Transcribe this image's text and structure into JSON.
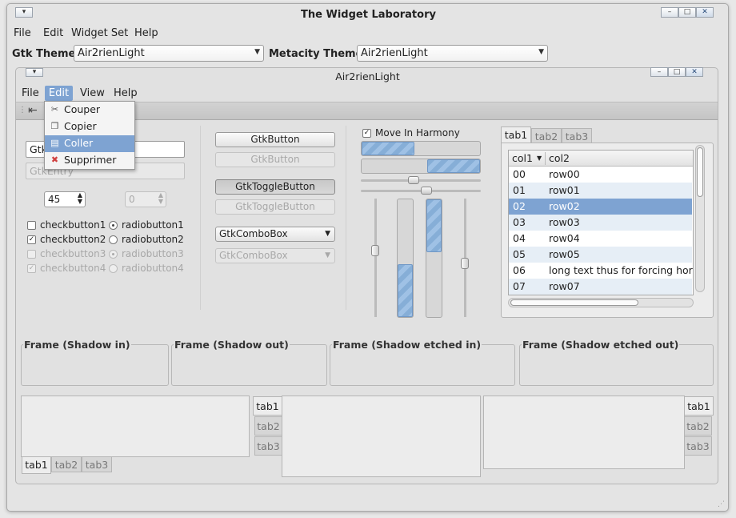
{
  "window": {
    "title": "The Widget Laboratory",
    "menu": [
      "File",
      "Edit",
      "Widget Set",
      "Help"
    ]
  },
  "themes": {
    "gtk_label": "Gtk Theme:",
    "gtk_value": "Air2rienLight",
    "metacity_label": "Metacity Theme:",
    "metacity_value": "Air2rienLight"
  },
  "preview": {
    "title": "Air2rienLight",
    "menu": [
      "File",
      "Edit",
      "View",
      "Help"
    ]
  },
  "edit_menu": [
    {
      "label": "Couper",
      "icon": "cut-icon"
    },
    {
      "label": "Copier",
      "icon": "copy-icon"
    },
    {
      "label": "Coller",
      "icon": "paste-icon"
    },
    {
      "label": "Supprimer",
      "icon": "delete-icon"
    }
  ],
  "left": {
    "entry": "Gtk",
    "entry_disabled": "GtkEntry",
    "spin1": "45",
    "spin2": "0",
    "checks": [
      {
        "label": "checkbutton1",
        "checked": false
      },
      {
        "label": "checkbutton2",
        "checked": true
      },
      {
        "label": "checkbutton3",
        "checked": false
      },
      {
        "label": "checkbutton4",
        "checked": true
      }
    ],
    "radios": [
      {
        "label": "radiobutton1",
        "selected": true
      },
      {
        "label": "radiobutton2",
        "selected": false
      },
      {
        "label": "radiobutton3",
        "selected": true
      },
      {
        "label": "radiobutton4",
        "selected": false
      }
    ]
  },
  "buttons": {
    "button": "GtkButton",
    "button_dis": "GtkButton",
    "toggle": "GtkToggleButton",
    "toggle_dis": "GtkToggleButton",
    "combo": "GtkComboBox",
    "combo_dis": "GtkComboBox"
  },
  "harmony": {
    "label": "Move In Harmony",
    "checked": true
  },
  "tree": {
    "tabs": [
      "tab1",
      "tab2",
      "tab3"
    ],
    "columns": [
      "col1",
      "col2"
    ],
    "rows": [
      [
        "00",
        "row00"
      ],
      [
        "01",
        "row01"
      ],
      [
        "02",
        "row02"
      ],
      [
        "03",
        "row03"
      ],
      [
        "04",
        "row04"
      ],
      [
        "05",
        "row05"
      ],
      [
        "06",
        "long text thus for forcing horiz"
      ],
      [
        "07",
        "row07"
      ]
    ],
    "selected_index": 2
  },
  "frames": [
    "Frame (Shadow in)",
    "Frame (Shadow out)",
    "Frame (Shadow etched in)",
    "Frame (Shadow etched out)"
  ],
  "notebooks": {
    "tabs": [
      "tab1",
      "tab2",
      "tab3"
    ]
  },
  "colors": {
    "accent": "#7ea3d2",
    "selection": "#7ea3d2"
  }
}
